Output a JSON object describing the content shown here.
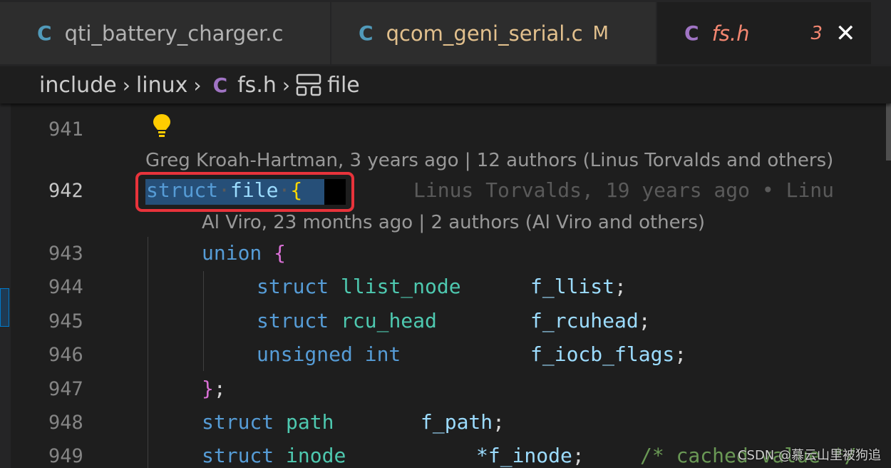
{
  "tabs": [
    {
      "icon": "C",
      "name": "qti_battery_charger.c",
      "badge": ""
    },
    {
      "icon": "C",
      "name": "qcom_geni_serial.c",
      "badge": "M"
    },
    {
      "icon": "C",
      "name": "fs.h",
      "badge": "3",
      "close": "✕"
    }
  ],
  "breadcrumb": {
    "part1": "include",
    "sep": "›",
    "part2": "linux",
    "file_icon": "C",
    "part3": "fs.h",
    "part4": "file"
  },
  "code_lens": {
    "line942": "Greg Kroah-Hartman, 3 years ago | 12 authors (Linus Torvalds and others)",
    "line943": "Al Viro, 23 months ago | 2 authors (Al Viro and others)"
  },
  "blame_ghost": "Linus Torvalds, 19 years ago • Linu",
  "lines": {
    "941": "941",
    "942": "942",
    "943": "943",
    "944": "944",
    "945": "945",
    "946": "946",
    "947": "947",
    "948": "948",
    "949": "949"
  },
  "code": {
    "l942_kw": "struct",
    "l942_sp": "·",
    "l942_id": "file",
    "l942_sp2": "·",
    "l942_br": "{",
    "l943_kw": "union",
    "l943_br": "{",
    "l944_kw": "struct",
    "l944_ty": "llist_node",
    "l944_id": "f_llist",
    "l944_pn": ";",
    "l945_kw": "struct",
    "l945_ty": "rcu_head",
    "l945_id": "f_rcuhead",
    "l945_pn": ";",
    "l946_kw1": "unsigned",
    "l946_kw2": "int",
    "l946_id": "f_iocb_flags",
    "l946_pn": ";",
    "l947_br": "}",
    "l947_pn": ";",
    "l948_kw": "struct",
    "l948_ty": "path",
    "l948_id": "f_path",
    "l948_pn": ";",
    "l949_kw": "struct",
    "l949_ty": "inode",
    "l949_id": "*f_inode",
    "l949_pn": ";",
    "l949_cm": "/* cached value */"
  },
  "watermark": "CSDN @慕云山里被狗追",
  "colors": {
    "keyword": "#569cd6",
    "type": "#4ec9b0",
    "identifier": "#9cdcfe",
    "highlight_box": "#e8333b"
  }
}
